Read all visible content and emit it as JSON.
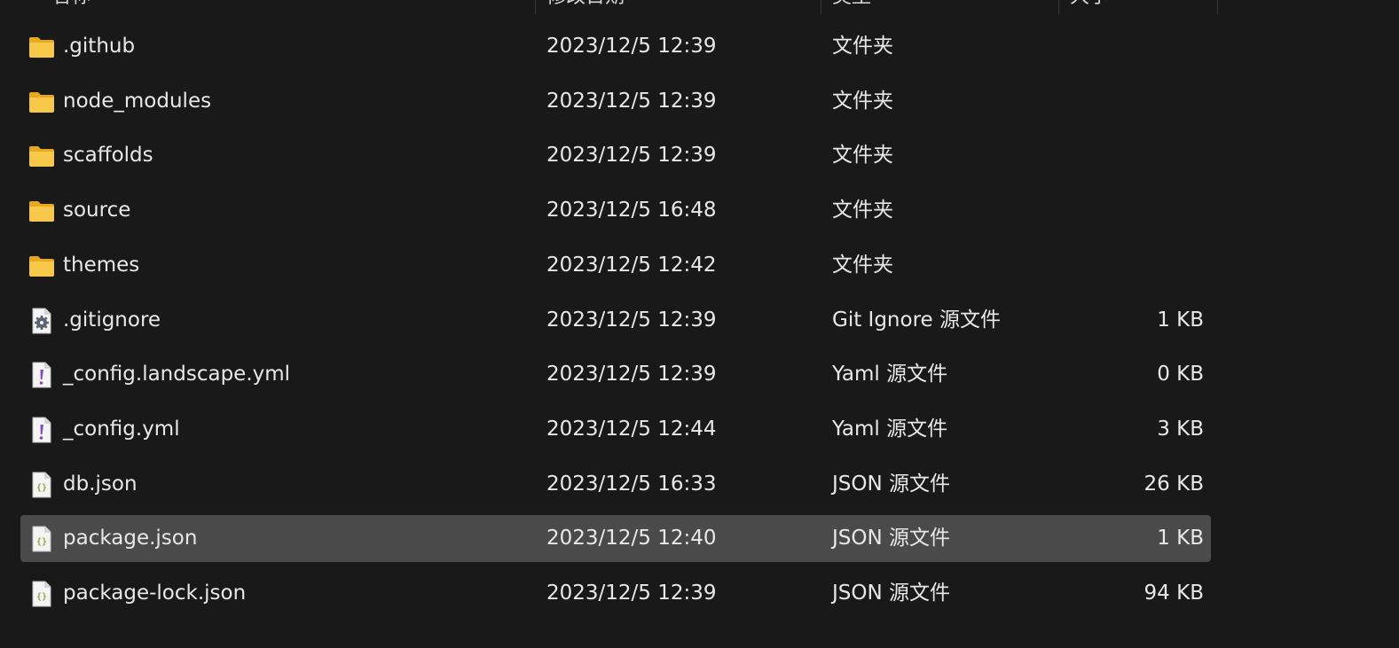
{
  "columns": {
    "name": "名称",
    "date": "修改日期",
    "type": "类型",
    "size": "大小"
  },
  "files": [
    {
      "name": ".github",
      "date": "2023/12/5 12:39",
      "type": "文件夹",
      "size": "",
      "icon": "folder-icon"
    },
    {
      "name": "node_modules",
      "date": "2023/12/5 12:39",
      "type": "文件夹",
      "size": "",
      "icon": "folder-icon"
    },
    {
      "name": "scaffolds",
      "date": "2023/12/5 12:39",
      "type": "文件夹",
      "size": "",
      "icon": "folder-icon"
    },
    {
      "name": "source",
      "date": "2023/12/5 16:48",
      "type": "文件夹",
      "size": "",
      "icon": "folder-icon"
    },
    {
      "name": "themes",
      "date": "2023/12/5 12:42",
      "type": "文件夹",
      "size": "",
      "icon": "folder-icon"
    },
    {
      "name": ".gitignore",
      "date": "2023/12/5 12:39",
      "type": "Git Ignore 源文件",
      "size": "1 KB",
      "icon": "settings-file-icon"
    },
    {
      "name": "_config.landscape.yml",
      "date": "2023/12/5 12:39",
      "type": "Yaml 源文件",
      "size": "0 KB",
      "icon": "yaml-file-icon"
    },
    {
      "name": "_config.yml",
      "date": "2023/12/5 12:44",
      "type": "Yaml 源文件",
      "size": "3 KB",
      "icon": "yaml-file-icon"
    },
    {
      "name": "db.json",
      "date": "2023/12/5 16:33",
      "type": "JSON 源文件",
      "size": "26 KB",
      "icon": "json-file-icon"
    },
    {
      "name": "package.json",
      "date": "2023/12/5 12:40",
      "type": "JSON 源文件",
      "size": "1 KB",
      "icon": "json-file-icon",
      "selected": true
    },
    {
      "name": "package-lock.json",
      "date": "2023/12/5 12:39",
      "type": "JSON 源文件",
      "size": "94 KB",
      "icon": "json-file-icon"
    }
  ],
  "colors": {
    "background": "#191919",
    "selected_row": "#4a4a4a",
    "folder": "#f5c343",
    "yaml_accent": "#8a4bb8",
    "json_accent": "#9aa53a"
  }
}
